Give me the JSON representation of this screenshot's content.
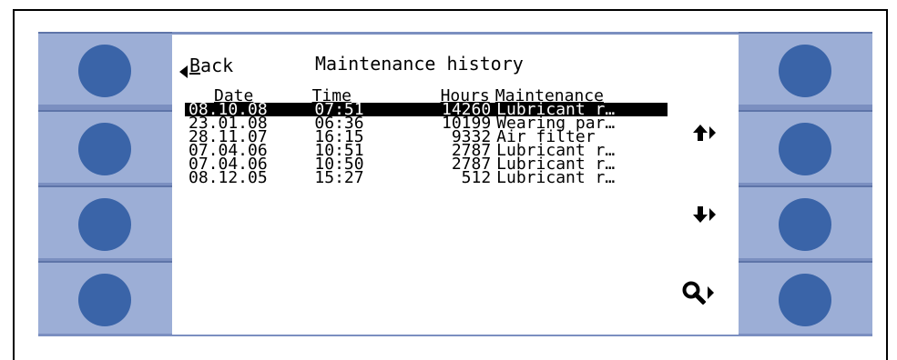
{
  "screen": {
    "back_label": "Back",
    "back_accel": "B",
    "back_rest": "ack",
    "title": "Maintenance history",
    "headers": {
      "date": "Date",
      "time": "Time",
      "hours": "Hours",
      "maintenance": "Maintenance"
    },
    "rows": [
      {
        "date": "08.10.08",
        "time": "07:51",
        "hours": "14260",
        "maintenance": "Lubricant r…",
        "selected": true
      },
      {
        "date": "23.01.08",
        "time": "06:36",
        "hours": "10199",
        "maintenance": "Wearing par…",
        "selected": false
      },
      {
        "date": "28.11.07",
        "time": "16:15",
        "hours": "9332",
        "maintenance": "Air filter",
        "selected": false
      },
      {
        "date": "07.04.06",
        "time": "10:51",
        "hours": "2787",
        "maintenance": "Lubricant r…",
        "selected": false
      },
      {
        "date": "07.04.06",
        "time": "10:50",
        "hours": "2787",
        "maintenance": "Lubricant r…",
        "selected": false
      },
      {
        "date": "08.12.05",
        "time": "15:27",
        "hours": "512",
        "maintenance": "Lubricant r…",
        "selected": false
      }
    ]
  },
  "icons": {
    "up": "up-arrow-icon",
    "down": "down-arrow-icon",
    "search": "magnifier-icon"
  },
  "colors": {
    "panel": "#7b8fc0",
    "key_cell": "#9caed6",
    "knob": "#3a64a8",
    "screen_bg": "#ffffff",
    "text": "#000000"
  }
}
